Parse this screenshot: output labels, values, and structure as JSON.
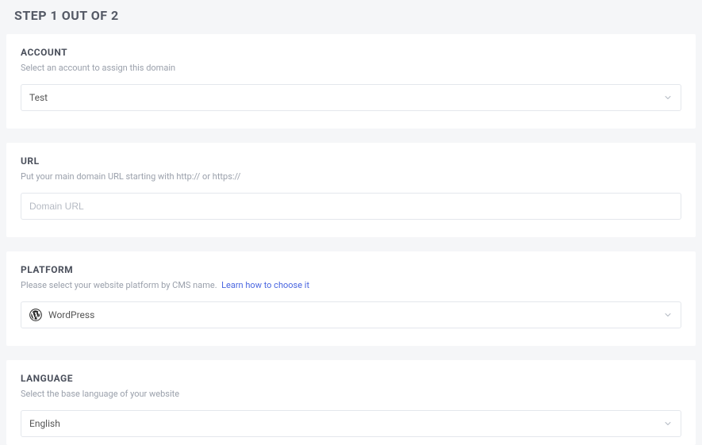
{
  "page": {
    "title": "STEP 1 OUT OF 2"
  },
  "account": {
    "label": "ACCOUNT",
    "desc": "Select an account to assign this domain",
    "value": "Test"
  },
  "url": {
    "label": "URL",
    "desc": "Put your main domain URL starting with http:// or https://",
    "placeholder": "Domain URL"
  },
  "platform": {
    "label": "PLATFORM",
    "desc": "Please select your website platform by CMS name.",
    "link_text": "Learn how to choose it",
    "value": "WordPress"
  },
  "language": {
    "label": "LANGUAGE",
    "desc": "Select the base language of your website",
    "value": "English"
  }
}
